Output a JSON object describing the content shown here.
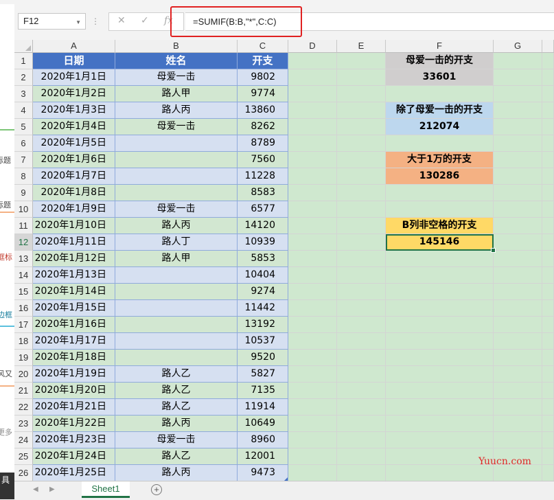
{
  "formula_bar": {
    "name_box": "F12",
    "formula": "=SUMIF(B:B,\"*\",C:C)",
    "icons": [
      "cancel-icon",
      "enter-icon",
      "function-icon"
    ],
    "highlight_color": "#e02020"
  },
  "grid": {
    "columns": [
      "A",
      "B",
      "C",
      "D",
      "E",
      "F",
      "G"
    ],
    "header_row": {
      "date": "日期",
      "name": "姓名",
      "amount": "开支"
    },
    "rows": [
      {
        "row": "2",
        "date": "2020年1月1日",
        "name": "母爱一击",
        "amount": "9802"
      },
      {
        "row": "3",
        "date": "2020年1月2日",
        "name": "路人甲",
        "amount": "9774"
      },
      {
        "row": "4",
        "date": "2020年1月3日",
        "name": "路人丙",
        "amount": "13860"
      },
      {
        "row": "5",
        "date": "2020年1月4日",
        "name": "母爱一击",
        "amount": "8262"
      },
      {
        "row": "6",
        "date": "2020年1月5日",
        "name": "",
        "amount": "8789"
      },
      {
        "row": "7",
        "date": "2020年1月6日",
        "name": "",
        "amount": "7560"
      },
      {
        "row": "8",
        "date": "2020年1月7日",
        "name": "",
        "amount": "11228"
      },
      {
        "row": "9",
        "date": "2020年1月8日",
        "name": "",
        "amount": "8583"
      },
      {
        "row": "10",
        "date": "2020年1月9日",
        "name": "母爱一击",
        "amount": "6577"
      },
      {
        "row": "11",
        "date": "2020年1月10日",
        "name": "路人丙",
        "amount": "14120"
      },
      {
        "row": "12",
        "date": "2020年1月11日",
        "name": "路人丁",
        "amount": "10939"
      },
      {
        "row": "13",
        "date": "2020年1月12日",
        "name": "路人甲",
        "amount": "5853"
      },
      {
        "row": "14",
        "date": "2020年1月13日",
        "name": "",
        "amount": "10404"
      },
      {
        "row": "15",
        "date": "2020年1月14日",
        "name": "",
        "amount": "9274"
      },
      {
        "row": "16",
        "date": "2020年1月15日",
        "name": "",
        "amount": "11442"
      },
      {
        "row": "17",
        "date": "2020年1月16日",
        "name": "",
        "amount": "13192"
      },
      {
        "row": "18",
        "date": "2020年1月17日",
        "name": "",
        "amount": "10537"
      },
      {
        "row": "19",
        "date": "2020年1月18日",
        "name": "",
        "amount": "9520"
      },
      {
        "row": "20",
        "date": "2020年1月19日",
        "name": "路人乙",
        "amount": "5827"
      },
      {
        "row": "21",
        "date": "2020年1月20日",
        "name": "路人乙",
        "amount": "7135"
      },
      {
        "row": "22",
        "date": "2020年1月21日",
        "name": "路人乙",
        "amount": "11914"
      },
      {
        "row": "23",
        "date": "2020年1月22日",
        "name": "路人丙",
        "amount": "10649"
      },
      {
        "row": "24",
        "date": "2020年1月23日",
        "name": "母爱一击",
        "amount": "8960"
      },
      {
        "row": "25",
        "date": "2020年1月24日",
        "name": "路人乙",
        "amount": "12001"
      },
      {
        "row": "26",
        "date": "2020年1月25日",
        "name": "路人丙",
        "amount": "9473"
      }
    ],
    "summaries": [
      {
        "label": "母爱一击的开支",
        "value": "33601",
        "color": "#d0cece"
      },
      {
        "label": "除了母爱一击的开支",
        "value": "212074",
        "color": "#bdd7ee"
      },
      {
        "label": "大于1万的开支",
        "value": "130286",
        "color": "#f4b183"
      },
      {
        "label": "B列非空格的开支",
        "value": "145146",
        "color": "#ffd966"
      }
    ],
    "selected_cell": "F12"
  },
  "sheet_tabs": {
    "active": "Sheet1",
    "add_icon": "plus-circle-icon"
  },
  "watermark": "Yuucn.com",
  "left_panel_fragments": [
    "标题",
    "标题",
    "框标",
    "边框",
    "风又",
    "更多",
    "具"
  ]
}
